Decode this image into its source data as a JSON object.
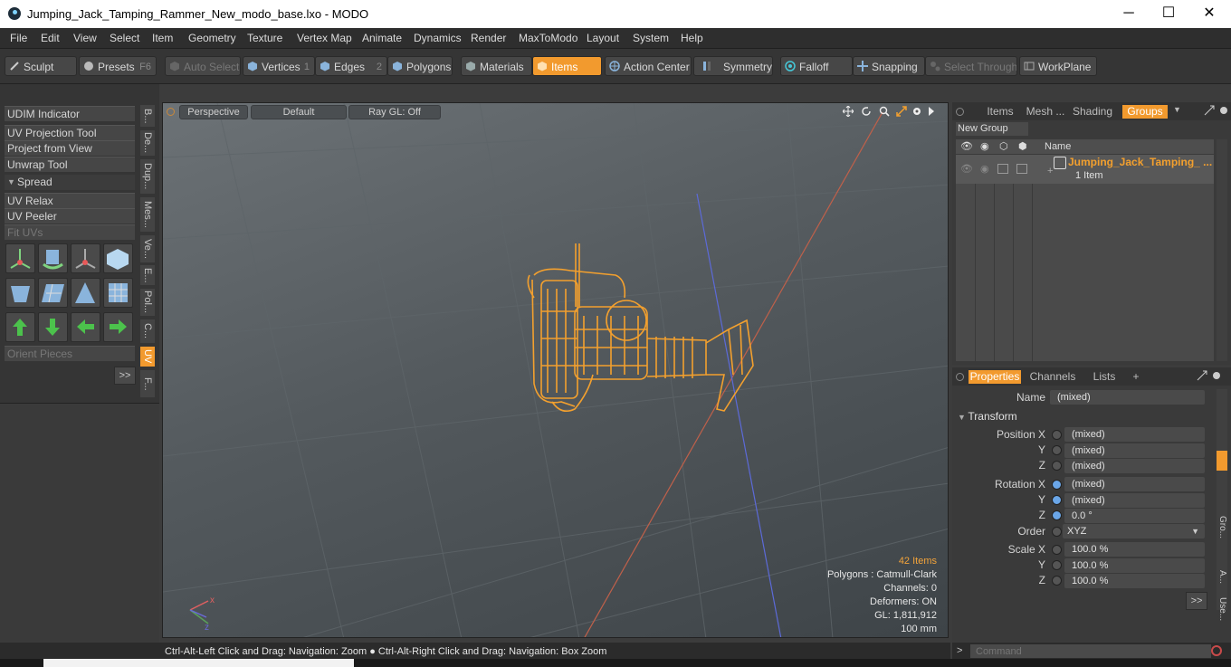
{
  "window": {
    "title": "Jumping_Jack_Tamping_Rammer_New_modo_base.lxo - MODO",
    "minimize": "─",
    "maximize": "☐",
    "close": "✕"
  },
  "menu": [
    "File",
    "Edit",
    "View",
    "Select",
    "Item",
    "Geometry",
    "Texture",
    "Vertex Map",
    "Animate",
    "Dynamics",
    "Render",
    "MaxToModo",
    "Layout",
    "System",
    "Help"
  ],
  "toolbar": {
    "sculpt": "Sculpt",
    "presets": "Presets",
    "presets_key": "F6",
    "auto_select": "Auto Select",
    "vertices": "Vertices",
    "vertices_key": "1",
    "edges": "Edges",
    "edges_key": "2",
    "polygons": "Polygons",
    "materials": "Materials",
    "items": "Items",
    "action_center": "Action Center",
    "symmetry": "Symmetry",
    "falloff": "Falloff",
    "snapping": "Snapping",
    "select_through": "Select Through",
    "workplane": "WorkPlane"
  },
  "left": {
    "udim": "UDIM Indicator",
    "uv_projection": "UV Projection Tool",
    "project_from_view": "Project from View",
    "unwrap": "Unwrap Tool",
    "spread": "Spread",
    "uv_relax": "UV Relax",
    "uv_peeler": "UV Peeler",
    "fit_uvs": "Fit UVs",
    "orient_pieces": "Orient Pieces",
    "more": ">>",
    "vtabs": [
      "B...",
      "De...",
      "Dup...",
      "Mes...",
      "Ve...",
      "E...",
      "Pol...",
      "C...",
      "UV",
      "F..."
    ]
  },
  "viewport": {
    "view": "Perspective",
    "shading": "Default",
    "raygl": "Ray GL: Off",
    "items_count": "42 Items",
    "polygons": "Polygons : Catmull-Clark",
    "channels": "Channels: 0",
    "deformers": "Deformers: ON",
    "gl": "GL: 1,811,912",
    "scale": "100 mm",
    "axis_x": "x",
    "axis_z": "z"
  },
  "status": {
    "hint": "Ctrl-Alt-Left Click and Drag: Navigation: Zoom ● Ctrl-Alt-Right Click and Drag: Navigation: Box Zoom"
  },
  "groups": {
    "tabs": [
      "Items",
      "Mesh ...",
      "Shading",
      "Groups"
    ],
    "new_group": "New Group",
    "name_col": "Name",
    "item_name": "Jumping_Jack_Tamping_ ...",
    "item_sub": "1 Item"
  },
  "properties": {
    "tabs": [
      "Properties",
      "Channels",
      "Lists",
      "+"
    ],
    "name_label": "Name",
    "name_value": "(mixed)",
    "transform": "Transform",
    "pos_x_label": "Position X",
    "y": "Y",
    "z": "Z",
    "rot_x_label": "Rotation X",
    "order_label": "Order",
    "order_value": "XYZ",
    "scale_x_label": "Scale X",
    "pos": [
      "(mixed)",
      "(mixed)",
      "(mixed)"
    ],
    "rot": [
      "(mixed)",
      "(mixed)",
      "0.0 °"
    ],
    "scale": [
      "100.0 %",
      "100.0 %",
      "100.0 %"
    ],
    "side_tabs": [
      "Gro...",
      "A...",
      "Use..."
    ],
    "more": ">>",
    "command_placeholder": "Command"
  },
  "colors": {
    "accent": "#f29a2e",
    "wire": "#f3a02e"
  }
}
